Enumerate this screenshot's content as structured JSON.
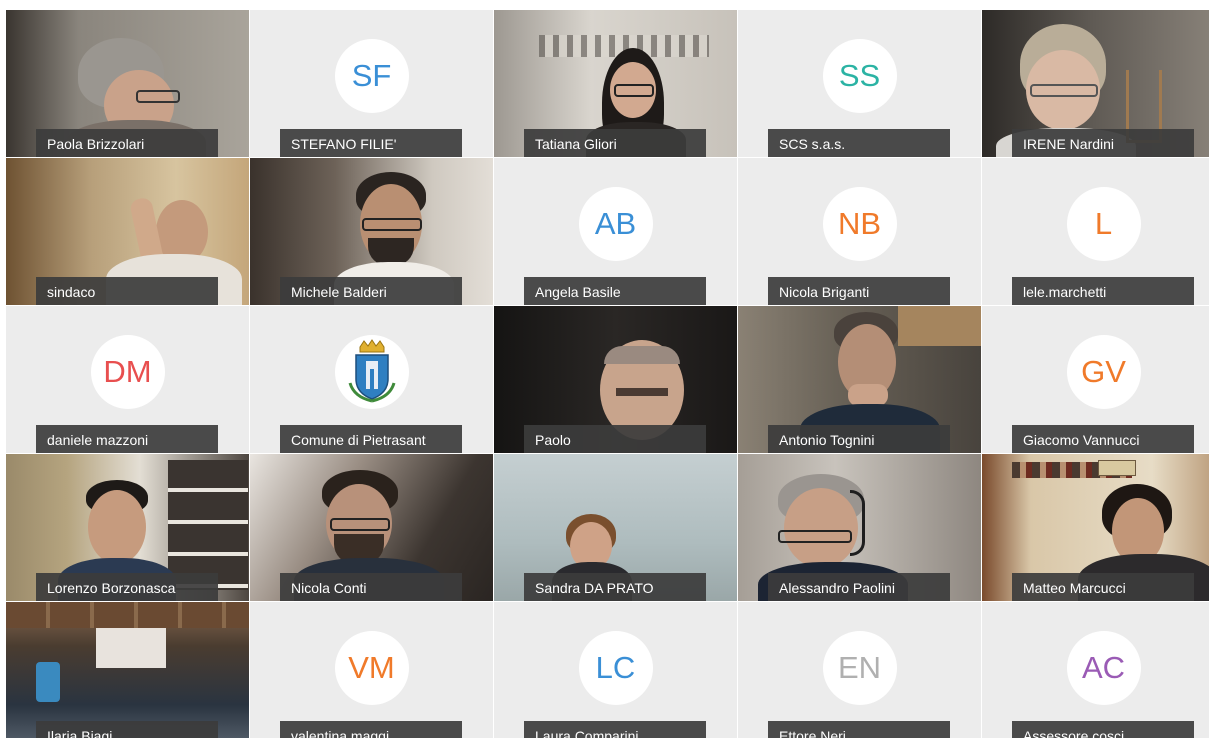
{
  "participants": [
    {
      "name": "Paola Brizzolari",
      "type": "video"
    },
    {
      "name": "STEFANO FILIE'",
      "type": "avatar",
      "initials": "SF",
      "color": "#3a8fd6"
    },
    {
      "name": "Tatiana Gliori",
      "type": "video"
    },
    {
      "name": "SCS s.a.s.",
      "type": "avatar",
      "initials": "SS",
      "color": "#2bb3a4"
    },
    {
      "name": "IRENE Nardini",
      "type": "video"
    },
    {
      "name": "sindaco",
      "type": "video"
    },
    {
      "name": "Michele Balderi",
      "type": "video"
    },
    {
      "name": "Angela Basile",
      "type": "avatar",
      "initials": "AB",
      "color": "#3a8fd6"
    },
    {
      "name": "Nicola Briganti",
      "type": "avatar",
      "initials": "NB",
      "color": "#f07a2a"
    },
    {
      "name": "lele.marchetti",
      "type": "avatar",
      "initials": "L",
      "color": "#f07a2a"
    },
    {
      "name": "daniele mazzoni",
      "type": "avatar",
      "initials": "DM",
      "color": "#e84f4f"
    },
    {
      "name": "Comune di Pietrasant",
      "type": "logo",
      "icon": "municipal-crest-icon"
    },
    {
      "name": "Paolo",
      "type": "video"
    },
    {
      "name": "Antonio Tognini",
      "type": "video"
    },
    {
      "name": "Giacomo Vannucci",
      "type": "avatar",
      "initials": "GV",
      "color": "#f07a2a"
    },
    {
      "name": "Lorenzo Borzonasca",
      "type": "video"
    },
    {
      "name": "Nicola Conti",
      "type": "video"
    },
    {
      "name": "Sandra DA PRATO",
      "type": "video"
    },
    {
      "name": "Alessandro Paolini",
      "type": "video"
    },
    {
      "name": "Matteo Marcucci",
      "type": "video"
    },
    {
      "name": "Ilaria Biagi",
      "type": "video"
    },
    {
      "name": "valentina maggi",
      "type": "avatar",
      "initials": "VM",
      "color": "#f07a2a"
    },
    {
      "name": "Laura Comparini",
      "type": "avatar",
      "initials": "LC",
      "color": "#3a8fd6"
    },
    {
      "name": "Ettore Neri",
      "type": "avatar",
      "initials": "EN",
      "color": "#b0b0b0"
    },
    {
      "name": "Assessore cosci",
      "type": "avatar",
      "initials": "AC",
      "color": "#9a5bb5"
    }
  ]
}
